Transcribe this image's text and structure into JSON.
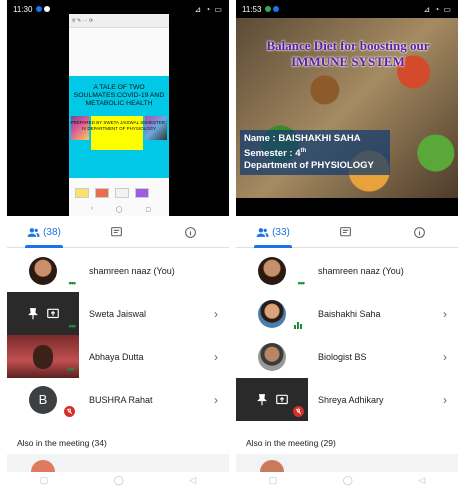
{
  "left": {
    "status": {
      "time": "11:30",
      "icons": "⊿ ◔ ▭"
    },
    "document": {
      "toolbar": "⚲ ✎ ⋯ ⟳",
      "slide_title": "A TALE OF TWO SOULMATES:COVID-19 AND METABOLIC HEALTH",
      "slide_sub": "PREPARED BY SWETA JAISWAL SEMESTER : IV DEPARTMENT OF PHYSIOLOGY",
      "nav": [
        "‹",
        "◯",
        "▢"
      ]
    },
    "tabs": {
      "people_count": "(38)"
    },
    "participants": [
      {
        "name": "shamreen naaz (You)"
      },
      {
        "name": "Sweta Jaiswal"
      },
      {
        "name": "Abhaya Dutta"
      },
      {
        "name": "BUSHRA Rahat",
        "initial": "B"
      }
    ],
    "also_label": "Also in the meeting (34)"
  },
  "right": {
    "status": {
      "time": "11:53",
      "icons": "⊿ ◔ ▭"
    },
    "slide": {
      "title": "Balance Diet for boosting our IMMUNE SYSTEM",
      "name_line": "Name : BAISHAKHI SAHA",
      "semester_label": "Semester : 4",
      "semester_sup": "th",
      "dept_line": "Department of PHYSIOLOGY"
    },
    "tabs": {
      "people_count": "(33)"
    },
    "participants": [
      {
        "name": "shamreen naaz (You)"
      },
      {
        "name": "Baishakhi Saha"
      },
      {
        "name": "Biologist BS"
      },
      {
        "name": "Shreya Adhikary"
      }
    ],
    "also_label": "Also in the meeting (29)"
  },
  "chevron": "›",
  "system_nav": [
    "▢",
    "◯",
    "◁"
  ],
  "colors": {
    "accent": "#1a73e8",
    "active_speaker": "#1e8e3e",
    "muted": "#d93025"
  },
  "icons": {
    "tab1": "people-icon",
    "tab2": "chat-icon",
    "tab3": "info-icon"
  }
}
